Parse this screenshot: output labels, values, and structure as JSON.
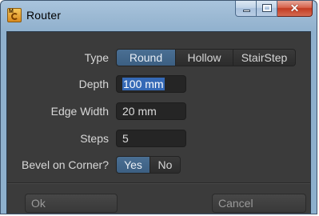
{
  "window": {
    "title": "Router"
  },
  "form": {
    "type": {
      "label": "Type",
      "options": [
        "Round",
        "Hollow",
        "StairStep"
      ],
      "selected": "Round"
    },
    "depth": {
      "label": "Depth",
      "value": "100 mm"
    },
    "edge_width": {
      "label": "Edge Width",
      "value": "20 mm"
    },
    "steps": {
      "label": "Steps",
      "value": "5"
    },
    "bevel_on_corner": {
      "label": "Bevel on Corner?",
      "options": [
        "Yes",
        "No"
      ],
      "selected": "Yes"
    }
  },
  "buttons": {
    "ok": "Ok",
    "cancel": "Cancel"
  },
  "icons": {
    "app": "router-app-icon",
    "minimize": "minimize-icon",
    "maximize": "maximize-icon",
    "close": "close-icon"
  },
  "colors": {
    "accent": "#4a6f93",
    "selection": "#3569b6",
    "panel": "#3b3b3b"
  }
}
